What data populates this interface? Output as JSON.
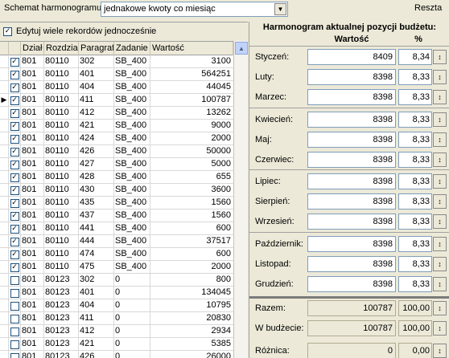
{
  "topbar": {
    "schema_label": "Schemat harmonogramu:",
    "schema_value": "jednakowe kwoty co miesiąc",
    "reset_label": "Reszta"
  },
  "left": {
    "multi_edit_label": "Edytuj wiele rekordów jednocześnie",
    "multi_edit_checked": true,
    "columns": [
      "Dział",
      "Rozdział",
      "Paragraf",
      "Zadanie",
      "Wartość"
    ],
    "rows": [
      {
        "checked": true,
        "current": false,
        "dzial": "801",
        "rozdzial": "80110",
        "paragraf": "302",
        "zadanie": "SB_400",
        "wartosc": "3100"
      },
      {
        "checked": true,
        "current": false,
        "dzial": "801",
        "rozdzial": "80110",
        "paragraf": "401",
        "zadanie": "SB_400",
        "wartosc": "564251"
      },
      {
        "checked": true,
        "current": false,
        "dzial": "801",
        "rozdzial": "80110",
        "paragraf": "404",
        "zadanie": "SB_400",
        "wartosc": "44045"
      },
      {
        "checked": true,
        "current": true,
        "dzial": "801",
        "rozdzial": "80110",
        "paragraf": "411",
        "zadanie": "SB_400",
        "wartosc": "100787"
      },
      {
        "checked": true,
        "current": false,
        "dzial": "801",
        "rozdzial": "80110",
        "paragraf": "412",
        "zadanie": "SB_400",
        "wartosc": "13262"
      },
      {
        "checked": true,
        "current": false,
        "dzial": "801",
        "rozdzial": "80110",
        "paragraf": "421",
        "zadanie": "SB_400",
        "wartosc": "9000"
      },
      {
        "checked": true,
        "current": false,
        "dzial": "801",
        "rozdzial": "80110",
        "paragraf": "424",
        "zadanie": "SB_400",
        "wartosc": "2000"
      },
      {
        "checked": true,
        "current": false,
        "dzial": "801",
        "rozdzial": "80110",
        "paragraf": "426",
        "zadanie": "SB_400",
        "wartosc": "50000"
      },
      {
        "checked": true,
        "current": false,
        "dzial": "801",
        "rozdzial": "80110",
        "paragraf": "427",
        "zadanie": "SB_400",
        "wartosc": "5000"
      },
      {
        "checked": true,
        "current": false,
        "dzial": "801",
        "rozdzial": "80110",
        "paragraf": "428",
        "zadanie": "SB_400",
        "wartosc": "655"
      },
      {
        "checked": true,
        "current": false,
        "dzial": "801",
        "rozdzial": "80110",
        "paragraf": "430",
        "zadanie": "SB_400",
        "wartosc": "3600"
      },
      {
        "checked": true,
        "current": false,
        "dzial": "801",
        "rozdzial": "80110",
        "paragraf": "435",
        "zadanie": "SB_400",
        "wartosc": "1560"
      },
      {
        "checked": true,
        "current": false,
        "dzial": "801",
        "rozdzial": "80110",
        "paragraf": "437",
        "zadanie": "SB_400",
        "wartosc": "1560"
      },
      {
        "checked": true,
        "current": false,
        "dzial": "801",
        "rozdzial": "80110",
        "paragraf": "441",
        "zadanie": "SB_400",
        "wartosc": "600"
      },
      {
        "checked": true,
        "current": false,
        "dzial": "801",
        "rozdzial": "80110",
        "paragraf": "444",
        "zadanie": "SB_400",
        "wartosc": "37517"
      },
      {
        "checked": true,
        "current": false,
        "dzial": "801",
        "rozdzial": "80110",
        "paragraf": "474",
        "zadanie": "SB_400",
        "wartosc": "600"
      },
      {
        "checked": true,
        "current": false,
        "dzial": "801",
        "rozdzial": "80110",
        "paragraf": "475",
        "zadanie": "SB_400",
        "wartosc": "2000"
      },
      {
        "checked": false,
        "current": false,
        "dzial": "801",
        "rozdzial": "80123",
        "paragraf": "302",
        "zadanie": "0",
        "wartosc": "800"
      },
      {
        "checked": false,
        "current": false,
        "dzial": "801",
        "rozdzial": "80123",
        "paragraf": "401",
        "zadanie": "0",
        "wartosc": "134045"
      },
      {
        "checked": false,
        "current": false,
        "dzial": "801",
        "rozdzial": "80123",
        "paragraf": "404",
        "zadanie": "0",
        "wartosc": "10795"
      },
      {
        "checked": false,
        "current": false,
        "dzial": "801",
        "rozdzial": "80123",
        "paragraf": "411",
        "zadanie": "0",
        "wartosc": "20830"
      },
      {
        "checked": false,
        "current": false,
        "dzial": "801",
        "rozdzial": "80123",
        "paragraf": "412",
        "zadanie": "0",
        "wartosc": "2934"
      },
      {
        "checked": false,
        "current": false,
        "dzial": "801",
        "rozdzial": "80123",
        "paragraf": "421",
        "zadanie": "0",
        "wartosc": "5385"
      },
      {
        "checked": false,
        "current": false,
        "dzial": "801",
        "rozdzial": "80123",
        "paragraf": "426",
        "zadanie": "0",
        "wartosc": "26000"
      }
    ]
  },
  "right": {
    "title": "Harmonogram aktualnej pozycji budżetu:",
    "col_value": "Wartość",
    "col_pct": "%",
    "lock_glyph": "↕",
    "months": [
      {
        "label": "Styczeń:",
        "value": "8409",
        "pct": "8,34"
      },
      {
        "label": "Luty:",
        "value": "8398",
        "pct": "8,33"
      },
      {
        "label": "Marzec:",
        "value": "8398",
        "pct": "8,33"
      },
      {
        "label": "Kwiecień:",
        "value": "8398",
        "pct": "8,33"
      },
      {
        "label": "Maj:",
        "value": "8398",
        "pct": "8,33"
      },
      {
        "label": "Czerwiec:",
        "value": "8398",
        "pct": "8,33"
      },
      {
        "label": "Lipiec:",
        "value": "8398",
        "pct": "8,33"
      },
      {
        "label": "Sierpień:",
        "value": "8398",
        "pct": "8,33"
      },
      {
        "label": "Wrzesień:",
        "value": "8398",
        "pct": "8,33"
      },
      {
        "label": "Październik:",
        "value": "8398",
        "pct": "8,33"
      },
      {
        "label": "Listopad:",
        "value": "8398",
        "pct": "8,33"
      },
      {
        "label": "Grudzień:",
        "value": "8398",
        "pct": "8,33"
      }
    ],
    "totals": [
      {
        "key": "sum",
        "label": "Razem:",
        "value": "100787",
        "pct": "100,00"
      },
      {
        "key": "budget",
        "label": "W budżecie:",
        "value": "100787",
        "pct": "100,00"
      },
      {
        "key": "diff",
        "label": "Różnica:",
        "value": "0",
        "pct": "0,00"
      }
    ]
  }
}
